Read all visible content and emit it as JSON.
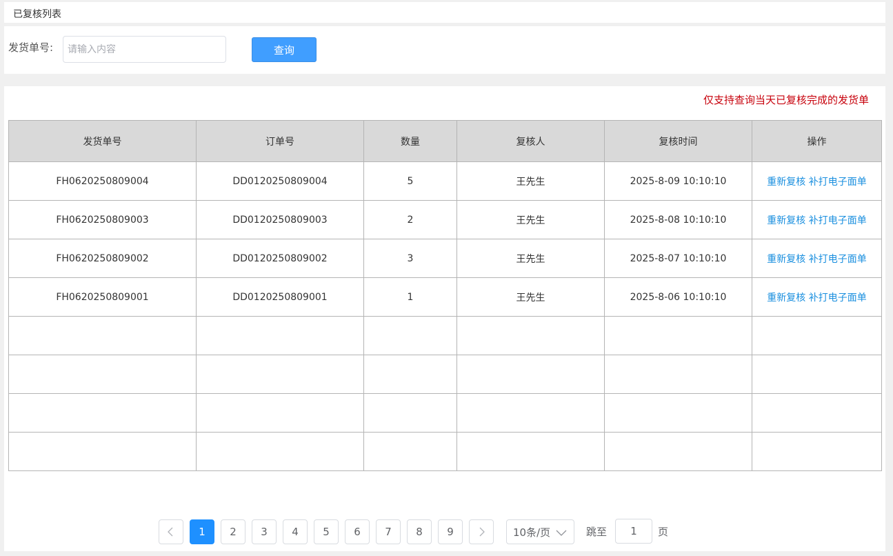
{
  "page_title": "已复核列表",
  "search": {
    "label": "发货单号:",
    "placeholder": "请输入内容",
    "value": "",
    "query_button": "查询"
  },
  "notice": "仅支持查询当天已复核完成的发货单",
  "table": {
    "columns": [
      "发货单号",
      "订单号",
      "数量",
      "复核人",
      "复核时间",
      "操作"
    ],
    "rows": [
      {
        "shipment_no": "FH0620250809004",
        "order_no": "DD0120250809004",
        "qty": "5",
        "reviewer": "王先生",
        "review_time": "2025-8-09 10:10:10",
        "action_recheck": "重新复核",
        "action_reprint": "补打电子面单"
      },
      {
        "shipment_no": "FH0620250809003",
        "order_no": "DD0120250809003",
        "qty": "2",
        "reviewer": "王先生",
        "review_time": "2025-8-08 10:10:10",
        "action_recheck": "重新复核",
        "action_reprint": "补打电子面单"
      },
      {
        "shipment_no": "FH0620250809002",
        "order_no": "DD0120250809002",
        "qty": "3",
        "reviewer": "王先生",
        "review_time": "2025-8-07 10:10:10",
        "action_recheck": "重新复核",
        "action_reprint": "补打电子面单"
      },
      {
        "shipment_no": "FH0620250809001",
        "order_no": "DD0120250809001",
        "qty": "1",
        "reviewer": "王先生",
        "review_time": "2025-8-06 10:10:10",
        "action_recheck": "重新复核",
        "action_reprint": "补打电子面单"
      }
    ],
    "empty_rows": 4
  },
  "pagination": {
    "pages": [
      "1",
      "2",
      "3",
      "4",
      "5",
      "6",
      "7",
      "8",
      "9"
    ],
    "current": "1",
    "page_size": "10条/页",
    "jump_label": "跳至",
    "jump_value": "1",
    "page_suffix": "页"
  },
  "colors": {
    "accent": "#409eff",
    "active_page": "#1e90ff",
    "link": "#1a8fdf",
    "notice": "#c7000b",
    "header_bg": "#d9d9d9"
  }
}
